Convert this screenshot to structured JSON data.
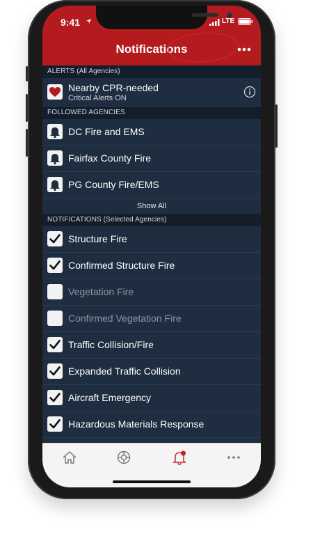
{
  "status": {
    "time": "9:41",
    "network": "LTE"
  },
  "header": {
    "title": "Notifications",
    "more_icon": "more-dots-icon"
  },
  "sections": {
    "alerts": "ALERTS (All Agencies)",
    "followed": "FOLLOWED AGENCIES",
    "notifications": "NOTIFICATIONS (Selected Agencies)"
  },
  "alert_row": {
    "title": "Nearby CPR-needed",
    "subtitle": "Critical Alerts ON",
    "icon": "heart-icon"
  },
  "agencies": [
    "DC Fire and EMS",
    "Fairfax County Fire",
    "PG County Fire/EMS"
  ],
  "show_all": "Show All",
  "notification_types": [
    {
      "label": "Structure Fire",
      "checked": true
    },
    {
      "label": "Confirmed Structure Fire",
      "checked": true
    },
    {
      "label": "Vegetation Fire",
      "checked": false
    },
    {
      "label": "Confirmed Vegetation Fire",
      "checked": false
    },
    {
      "label": "Traffic Collision/Fire",
      "checked": true
    },
    {
      "label": "Expanded Traffic Collision",
      "checked": true
    },
    {
      "label": "Aircraft Emergency",
      "checked": true
    },
    {
      "label": "Hazardous Materials Response",
      "checked": true
    }
  ],
  "tabs": [
    {
      "icon": "home-icon",
      "active": false
    },
    {
      "icon": "fire-emblem-icon",
      "active": false
    },
    {
      "icon": "bell-alert-icon",
      "active": true
    },
    {
      "icon": "more-dots-icon",
      "active": false
    }
  ],
  "colors": {
    "brand_red": "#b31b1e",
    "list_bg": "#1e2d3f",
    "section_bg": "#141e2b",
    "annotation": "#d12a2f"
  }
}
